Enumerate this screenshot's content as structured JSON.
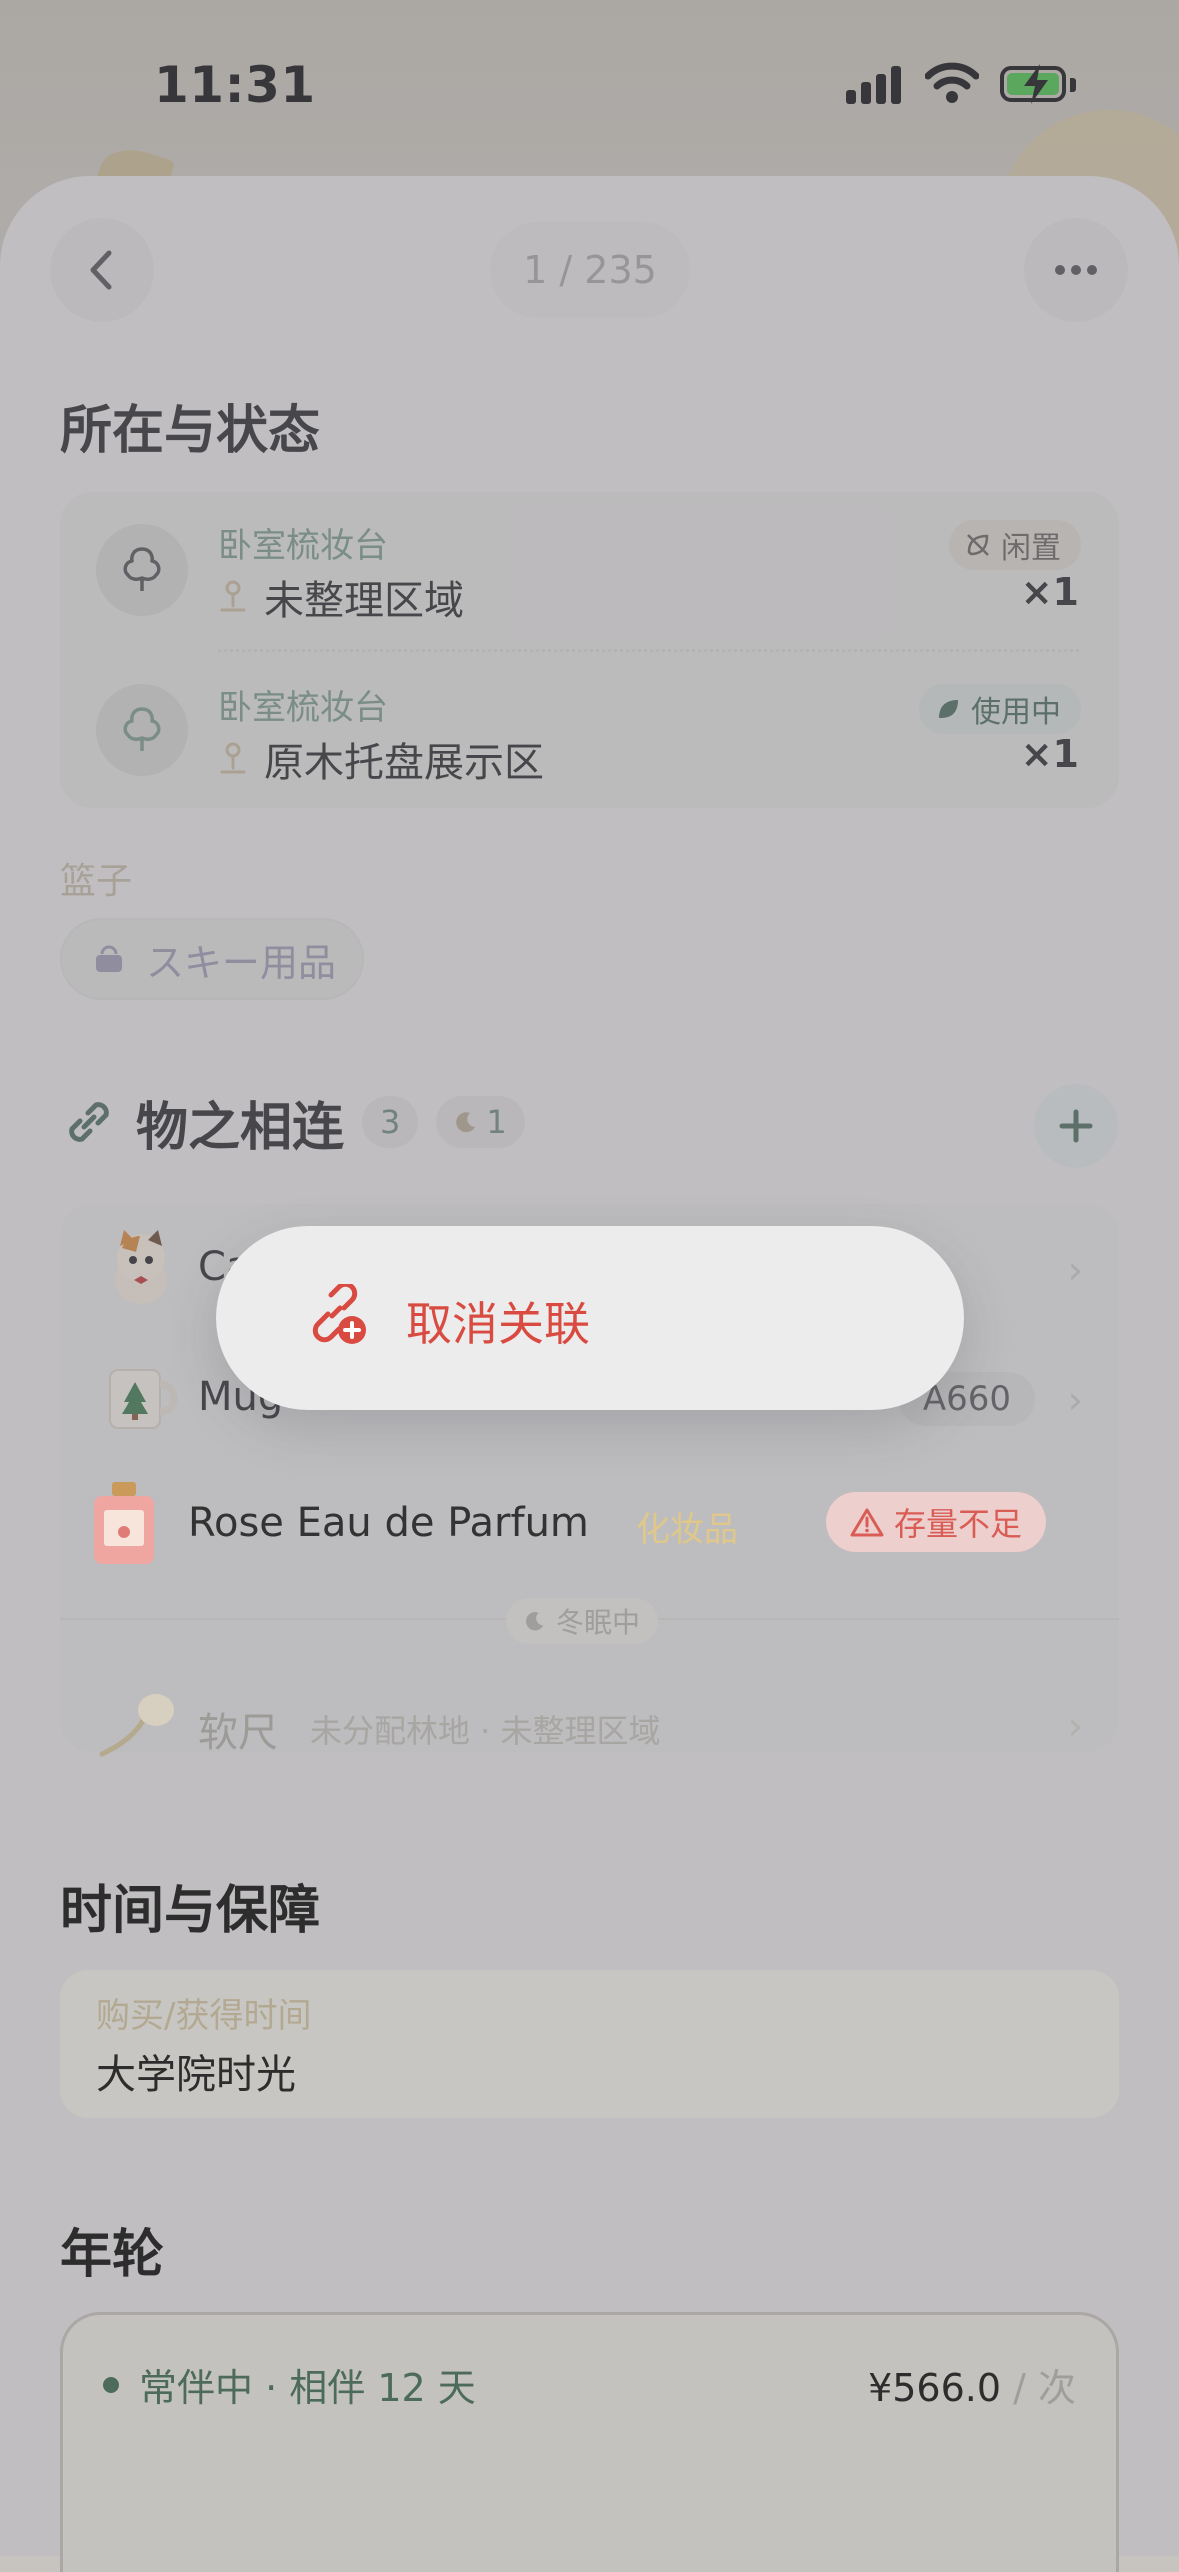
{
  "status_bar": {
    "time": "11:31"
  },
  "nav": {
    "pager": "1 / 235"
  },
  "sections": {
    "location_title": "所在与状态",
    "relations_title": "物之相连",
    "time_title": "时间与保障",
    "rings_title": "年轮"
  },
  "locations": [
    {
      "parent": "卧室梳妆台",
      "name": "未整理区域",
      "status": "闲置",
      "qty": "×1"
    },
    {
      "parent": "卧室梳妆台",
      "name": "原木托盘展示区",
      "status": "使用中",
      "qty": "×1"
    }
  ],
  "basket": {
    "label": "篮子",
    "chip": "スキー用品"
  },
  "relations": {
    "count": "3",
    "hibernating_count": "1",
    "items": [
      {
        "name": "Ca",
        "thumb": "cat-plush"
      },
      {
        "name": "Mug",
        "code": "A660",
        "thumb": "christmas-mug"
      },
      {
        "name": "Rose Eau de Parfum",
        "category": "化妆品",
        "warning": "存量不足",
        "thumb": "perfume-bottle"
      }
    ],
    "hibernating_label": "冬眠中",
    "hibernating_item": {
      "name": "软尺",
      "meta": "未分配林地 · 未整理区域"
    }
  },
  "context_menu": {
    "unlink_label": "取消关联"
  },
  "time_card": {
    "label": "购买/获得时间",
    "value": "大学院时光"
  },
  "rings": {
    "status": "常伴中 · 相伴 12 天",
    "price": "¥566.0",
    "unit": " / 次"
  },
  "colors": {
    "accent_green": "#4d6b5b",
    "danger_red": "#d94a40",
    "warning_yellow": "#e0c88a"
  }
}
